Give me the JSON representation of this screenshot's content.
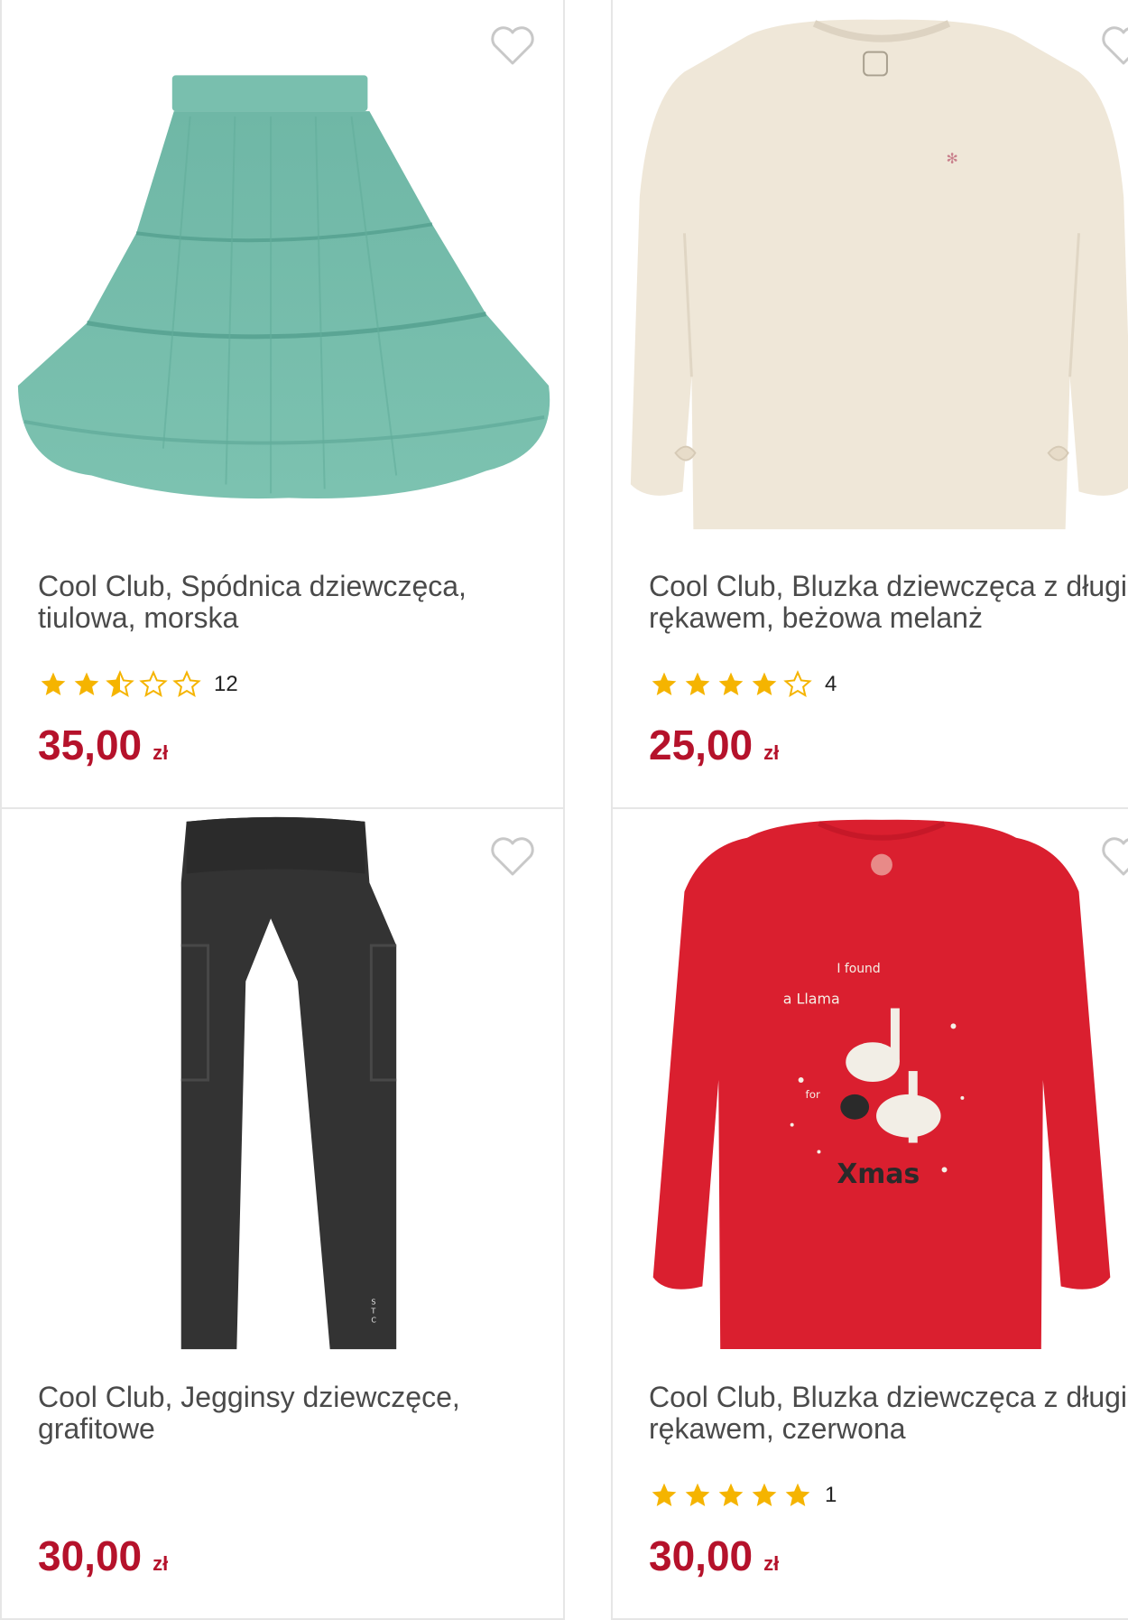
{
  "products": [
    {
      "title": "Cool Club, Spódnica dziewczęca, tiulowa, morska",
      "rating": 2.5,
      "review_count": "12",
      "price": "35,00",
      "currency": "zł",
      "image": "teal tulle skirt"
    },
    {
      "title": "Cool Club, Bluzka dziewczęca z długim rękawem, beżowa melanż",
      "rating": 4,
      "review_count": "4",
      "price": "25,00",
      "currency": "zł",
      "image": "beige long-sleeve blouse"
    },
    {
      "title": "Cool Club, Jegginsy dziewczęce, grafitowe",
      "price": "30,00",
      "currency": "zł",
      "image": "graphite jeggings"
    },
    {
      "title": "Cool Club, Bluzka dziewczęca z długim rękawem, czerwona",
      "rating": 5,
      "review_count": "1",
      "price": "30,00",
      "currency": "zł",
      "image": "red long-sleeve blouse",
      "print_text": [
        "I found",
        "a Llama",
        "for",
        "Xmas"
      ]
    }
  ],
  "colors": {
    "price": "#b5122b",
    "star": "#f5b400",
    "title": "#4a4a4a"
  }
}
